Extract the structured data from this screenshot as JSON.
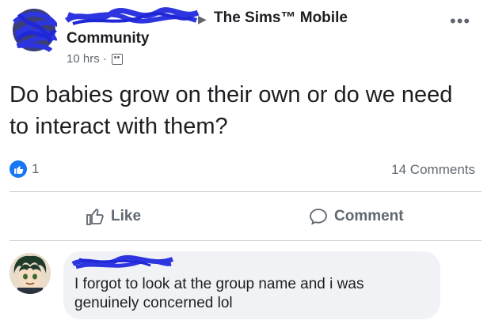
{
  "post": {
    "group_name": "The Sims™ Mobile",
    "group_name_line2": "Community",
    "time": "10 hrs ·",
    "text": "Do babies grow on their own or do we need to interact with them?",
    "more": "•••"
  },
  "engagement": {
    "like_count": "1",
    "comments_count": "14 Comments"
  },
  "actions": {
    "like_label": "Like",
    "comment_label": "Comment"
  },
  "comment": {
    "text": "I forgot to look at the group name and i was genuinely concerned lol"
  },
  "colors": {
    "facebook_blue": "#1877f2",
    "scribble_blue": "#2d35e0",
    "gray_text": "#606770",
    "bubble_bg": "#f0f2f5"
  }
}
